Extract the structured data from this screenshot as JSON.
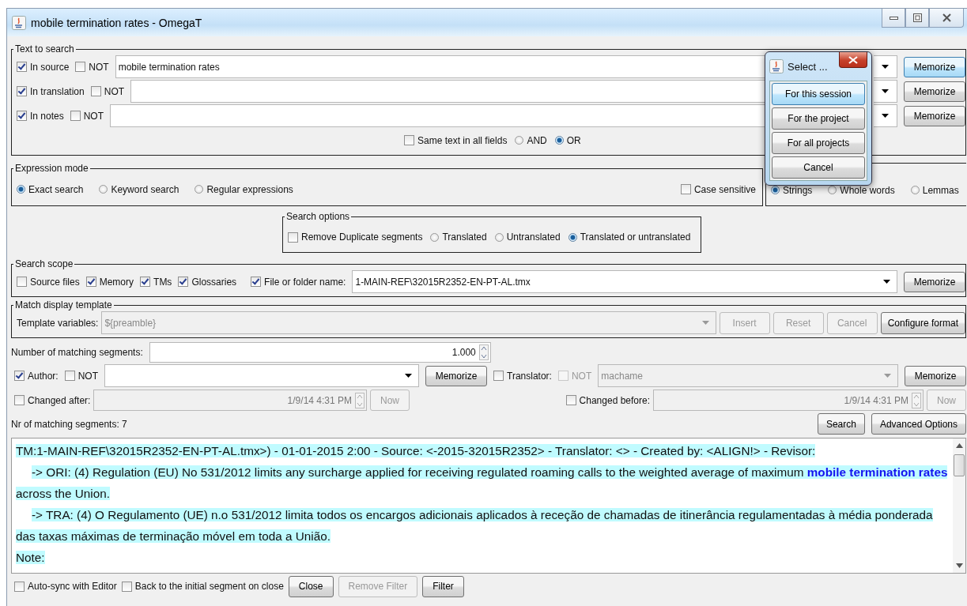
{
  "window": {
    "title": "mobile termination rates - OmegaT"
  },
  "text_to_search": {
    "title": "Text to search",
    "rows": [
      {
        "label": "In source",
        "checked": true,
        "not_label": "NOT",
        "not_checked": false,
        "value": "mobile termination rates",
        "button": "Memorize",
        "focused": true
      },
      {
        "label": "In translation",
        "checked": true,
        "not_label": "NOT",
        "not_checked": false,
        "button": "Memorize",
        "focused": false
      },
      {
        "label": "In notes",
        "checked": true,
        "not_label": "NOT",
        "not_checked": false,
        "button": "Memorize",
        "focused": false
      }
    ],
    "same_text": {
      "label": "Same text in all fields",
      "checked": false
    },
    "logic": [
      {
        "label": "AND",
        "selected": false
      },
      {
        "label": "OR",
        "selected": true
      }
    ]
  },
  "expression_mode": {
    "title": "Expression mode",
    "modes": [
      {
        "label": "Exact search",
        "selected": true
      },
      {
        "label": "Keyword search",
        "selected": false
      },
      {
        "label": "Regular expressions",
        "selected": false
      }
    ],
    "case_sensitive": {
      "label": "Case sensitive",
      "checked": false
    },
    "match": [
      {
        "label": "Strings",
        "selected": true
      },
      {
        "label": "Whole words",
        "selected": false
      },
      {
        "label": "Lemmas",
        "selected": false
      }
    ]
  },
  "search_options": {
    "title": "Search options",
    "remove_duplicates": {
      "label": "Remove Duplicate segments",
      "checked": false
    },
    "states": [
      {
        "label": "Translated",
        "selected": false
      },
      {
        "label": "Untranslated",
        "selected": false
      },
      {
        "label": "Translated or untranslated",
        "selected": true
      }
    ]
  },
  "search_scope": {
    "title": "Search scope",
    "items": [
      {
        "label": "Source files",
        "checked": false
      },
      {
        "label": "Memory",
        "checked": true
      },
      {
        "label": "TMs",
        "checked": true
      },
      {
        "label": "Glossaries",
        "checked": true
      }
    ],
    "file": {
      "label": "File or folder name:",
      "checked": true,
      "value": "1-MAIN-REF\\32015R2352-EN-PT-AL.tmx",
      "button": "Memorize"
    }
  },
  "template": {
    "title": "Match display template",
    "label": "Template variables:",
    "value": "${preamble}",
    "disabled": true,
    "buttons": [
      {
        "label": "Insert",
        "disabled": true
      },
      {
        "label": "Reset",
        "disabled": true
      },
      {
        "label": "Cancel",
        "disabled": true
      },
      {
        "label": "Configure format",
        "disabled": false
      }
    ]
  },
  "matching": {
    "label": "Number of matching segments:",
    "value": "1.000"
  },
  "author": {
    "label": "Author:",
    "checked": true,
    "not_label": "NOT",
    "not_checked": false,
    "disabled": false,
    "button": "Memorize"
  },
  "translator": {
    "label": "Translator:",
    "checked": false,
    "not_label": "NOT",
    "not_checked": false,
    "disabled": true,
    "value": "machame",
    "button": "Memorize"
  },
  "changed_after": {
    "label": "Changed after:",
    "checked": false,
    "value": "1/9/14 4:31 PM",
    "disabled": true,
    "button": "Now"
  },
  "changed_before": {
    "label": "Changed before:",
    "checked": false,
    "value": "1/9/14 4:31 PM",
    "disabled": true,
    "button": "Now"
  },
  "count": "Nr of matching segments: 7",
  "actions": [
    "Search",
    "Advanced Options"
  ],
  "results": [
    {
      "kind": "header",
      "text": "TM:1-MAIN-REF\\32015R2352-EN-PT-AL.tmx>) - 01-01-2015 2:00 - Source: <-2015-32015R2352> - Translator: <> - Created by: <ALIGN!> - Revisor:"
    },
    {
      "kind": "entry",
      "text": "->  ORI: (4) Regulation (EU) No 531/2012 limits any surcharge applied for receiving regulated roaming calls to the weighted average of maximum **mobile termination rates**"
    },
    {
      "kind": "continued",
      "text": "across the Union."
    },
    {
      "kind": "entry",
      "text": "-> TRA: (4) O Regulamento (UE) n.o 531/2012 limita todos os encargos adicionais aplicados à receção de chamadas de itinerância regulamentadas à média ponderada"
    },
    {
      "kind": "continued",
      "text": "das taxas máximas de terminação móvel em toda a União."
    },
    {
      "kind": "header",
      "text": "Note:"
    }
  ],
  "footer": {
    "checks": [
      {
        "label": "Auto-sync with Editor",
        "checked": false
      },
      {
        "label": "Back to the initial segment on close",
        "checked": false
      }
    ],
    "buttons": [
      {
        "label": "Close",
        "disabled": false
      },
      {
        "label": "Remove Filter",
        "disabled": true
      },
      {
        "label": "Filter",
        "disabled": false
      }
    ]
  },
  "popup": {
    "title": "Select ...",
    "buttons": [
      {
        "label": "For this session",
        "focused": true
      },
      {
        "label": "For the project",
        "focused": false
      },
      {
        "label": "For all projects",
        "focused": false
      },
      {
        "label": "Cancel",
        "focused": false
      }
    ]
  }
}
